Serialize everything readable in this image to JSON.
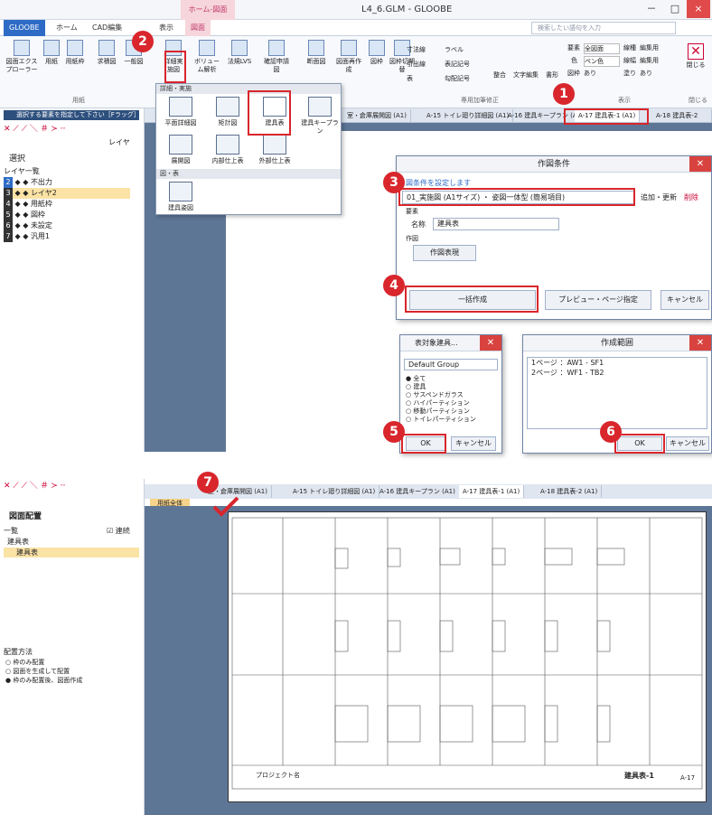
{
  "titlebar": {
    "context_tab": "ホーム-図面",
    "title": "L4_6.GLM - GLOOBE",
    "minimize": "－",
    "restore": "□",
    "close": "×"
  },
  "tabs": [
    "GLOOBE",
    "ホーム",
    "CAD編集",
    "表示",
    "図面"
  ],
  "search_placeholder": "検索したい語句を入力",
  "ribbon": {
    "buttons": [
      "図面エクスプローラー",
      "用紙",
      "用紙枠",
      "求積図",
      "一般図",
      "詳細実施図",
      "ボリューム解析",
      "法規LVS",
      "確認申請図",
      "断面図",
      "図面再作成",
      "図枠",
      "図枠切期替"
    ],
    "small": [
      "寸法線",
      "ラベル",
      "引出線",
      "表記記号",
      "表",
      "勾配記号",
      "整合",
      "文字編集",
      "書形"
    ],
    "props": [
      "要素",
      "全図面",
      "色",
      "ペン色",
      "図枠",
      "あり",
      "線種",
      "編集用",
      "線幅",
      "編集用",
      "塗り",
      "あり"
    ],
    "closebtn": "閉じる",
    "groups": [
      "用紙",
      "専用加筆修正",
      "表示",
      "閉じる"
    ]
  },
  "dropdown": {
    "head1": "詳細・実施",
    "items": [
      "平面詳細図",
      "矩計図",
      "建具表",
      "建具キープラン",
      "展開図",
      "内部仕上表",
      "外部仕上表"
    ],
    "head2": "図・表",
    "items2": [
      "建具姿図"
    ]
  },
  "leftpanel": {
    "prompt": "選択する要素を指定して下さい［Fラッグ］",
    "select_label": "選択",
    "layer_list": "レイヤ一覧",
    "layer_btn": "レイヤ",
    "layers": [
      {
        "num": "2",
        "name": "不出力"
      },
      {
        "num": "3",
        "name": "レイヤ2"
      },
      {
        "num": "4",
        "name": "用紙枠"
      },
      {
        "num": "5",
        "name": "図枠"
      },
      {
        "num": "6",
        "name": "未設定"
      },
      {
        "num": "7",
        "name": "汎用1"
      }
    ]
  },
  "doctabs": [
    "室・倉庫展開図 (A1)",
    "A-15 トイレ廻り詳細図 (A1)",
    "A-16 建具キープラン (A1)",
    "A-17 建具表-1 (A1)",
    "A-18 建具表-2 (A1)"
  ],
  "doctab_prefix": "用",
  "dialog_main": {
    "title": "作図条件",
    "set_label": "図条件を設定します",
    "preset": "01_実施図 (A1サイズ) ・ 姿図一体型 (簡易項目)",
    "add_update": "追加・更新",
    "delete": "削除",
    "name_section": "要素",
    "name_label": "名称",
    "name_value": "建具表",
    "draw_section": "作図",
    "draw_btn": "作図表現",
    "batch_btn": "一括作成",
    "preview_btn": "プレビュー・ページ指定",
    "cancel_btn": "キャンセル"
  },
  "dialog_target": {
    "title": "表対象建具...",
    "group": "Default Group",
    "options": [
      "全て",
      "建具",
      "サスペンドガラス",
      "ハイパーティション",
      "移動パーティション",
      "トイレパーティション"
    ],
    "ok": "OK",
    "cancel": "キャンセル"
  },
  "dialog_range": {
    "title": "作成範囲",
    "pages": [
      "1ページ ：AW1 - SF1",
      "2ページ ：WF1 - TB2"
    ],
    "ok": "OK",
    "cancel": "キャンセル"
  },
  "bottom": {
    "panel_title": "図面配置",
    "list_label": "一覧",
    "continuous": "連続",
    "tree_parent": "建具表",
    "tree_child": "建具表",
    "method_label": "配置方法",
    "methods": [
      "枠のみ配置",
      "図面を生成して配置",
      "枠のみ配置後、図面作成"
    ],
    "doctabs": [
      "室・倉庫展開図 (A1)",
      "A-15 トイレ廻り詳細図 (A1)",
      "A-16 建具キープラン (A1)",
      "A-17 建具表-1 (A1)",
      "A-18 建具表-2 (A1)"
    ],
    "sheet_tab": "用紙全体",
    "sheet_title": "建具表-1",
    "sheet_no": "A-17",
    "project": "プロジェクト名"
  },
  "steps": [
    "1",
    "2",
    "3",
    "4",
    "5",
    "6",
    "7"
  ],
  "colors": {
    "accent": "#2e6bc6",
    "highlight": "#d8262c",
    "canvas": "#5e7696"
  }
}
